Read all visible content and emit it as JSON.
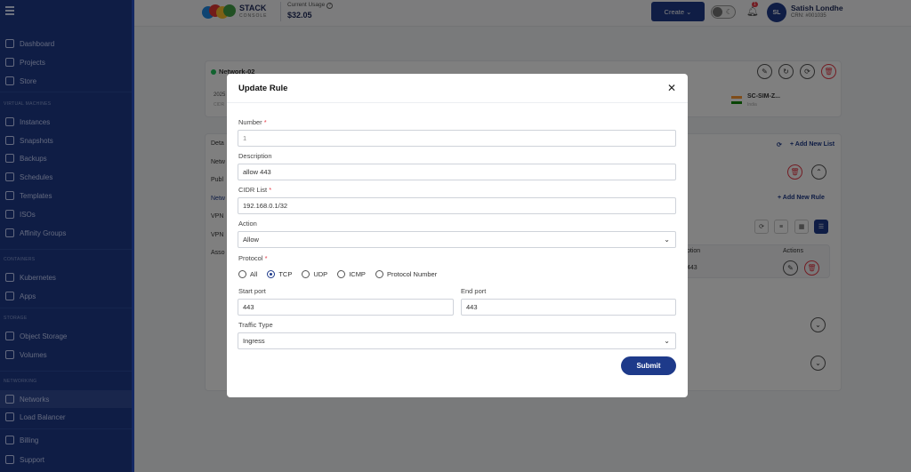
{
  "header": {
    "brand_main": "STACK",
    "brand_sub": "CONSOLE",
    "usage_label": "Current Usage",
    "usage_help": "?",
    "usage_value": "$32.05",
    "create_label": "Create ⌄",
    "notification_count": "1",
    "avatar_initials": "SL",
    "user_name": "Satish Londhe",
    "user_crn": "CRN: #001035"
  },
  "sidebar": {
    "items": [
      {
        "label": "Dashboard"
      },
      {
        "label": "Projects"
      },
      {
        "label": "Store"
      },
      {
        "label": "Instances"
      },
      {
        "label": "Snapshots"
      },
      {
        "label": "Backups"
      },
      {
        "label": "Schedules"
      },
      {
        "label": "Templates"
      },
      {
        "label": "ISOs"
      },
      {
        "label": "Affinity Groups"
      },
      {
        "label": "Kubernetes"
      },
      {
        "label": "Apps"
      },
      {
        "label": "Object Storage"
      },
      {
        "label": "Volumes"
      },
      {
        "label": "Networks"
      },
      {
        "label": "Load Balancer"
      },
      {
        "label": "Billing"
      },
      {
        "label": "Support"
      }
    ],
    "sections": {
      "virtual_machines": "VIRTUAL MACHINES",
      "containers": "CONTAINERS",
      "storage": "STORAGE",
      "networking": "NETWORKING"
    }
  },
  "background": {
    "network_name": "Network-02",
    "date_fragment": "2025",
    "cidr_fragment": "CIDR",
    "zone": "SC-SIM-Z...",
    "zone_sub": "India",
    "tabs": [
      "Deta",
      "Netw",
      "Publ",
      "Netw",
      "VPN",
      "VPN",
      "Asso"
    ],
    "add_new_list": "+ Add New List",
    "add_new_rule": "+ Add New Rule",
    "col_description": "ption",
    "col_actions": "Actions",
    "row_port": "443"
  },
  "modal": {
    "title": "Update Rule",
    "number_label": "Number",
    "number_placeholder": "1",
    "description_label": "Description",
    "description_value": "allow 443",
    "cidr_label": "CIDR List",
    "cidr_value": "192.168.0.1/32",
    "action_label": "Action",
    "action_value": "Allow",
    "protocol_label": "Protocol",
    "protocol_options": [
      "All",
      "TCP",
      "UDP",
      "ICMP",
      "Protocol Number"
    ],
    "protocol_selected": "TCP",
    "start_port_label": "Start port",
    "start_port_value": "443",
    "end_port_label": "End port",
    "end_port_value": "443",
    "traffic_label": "Traffic Type",
    "traffic_value": "Ingress",
    "submit_label": "Submit",
    "required_mark": "*"
  },
  "colors": {
    "primary": "#1e3a8a",
    "danger": "#e63946",
    "success": "#22c55e"
  }
}
